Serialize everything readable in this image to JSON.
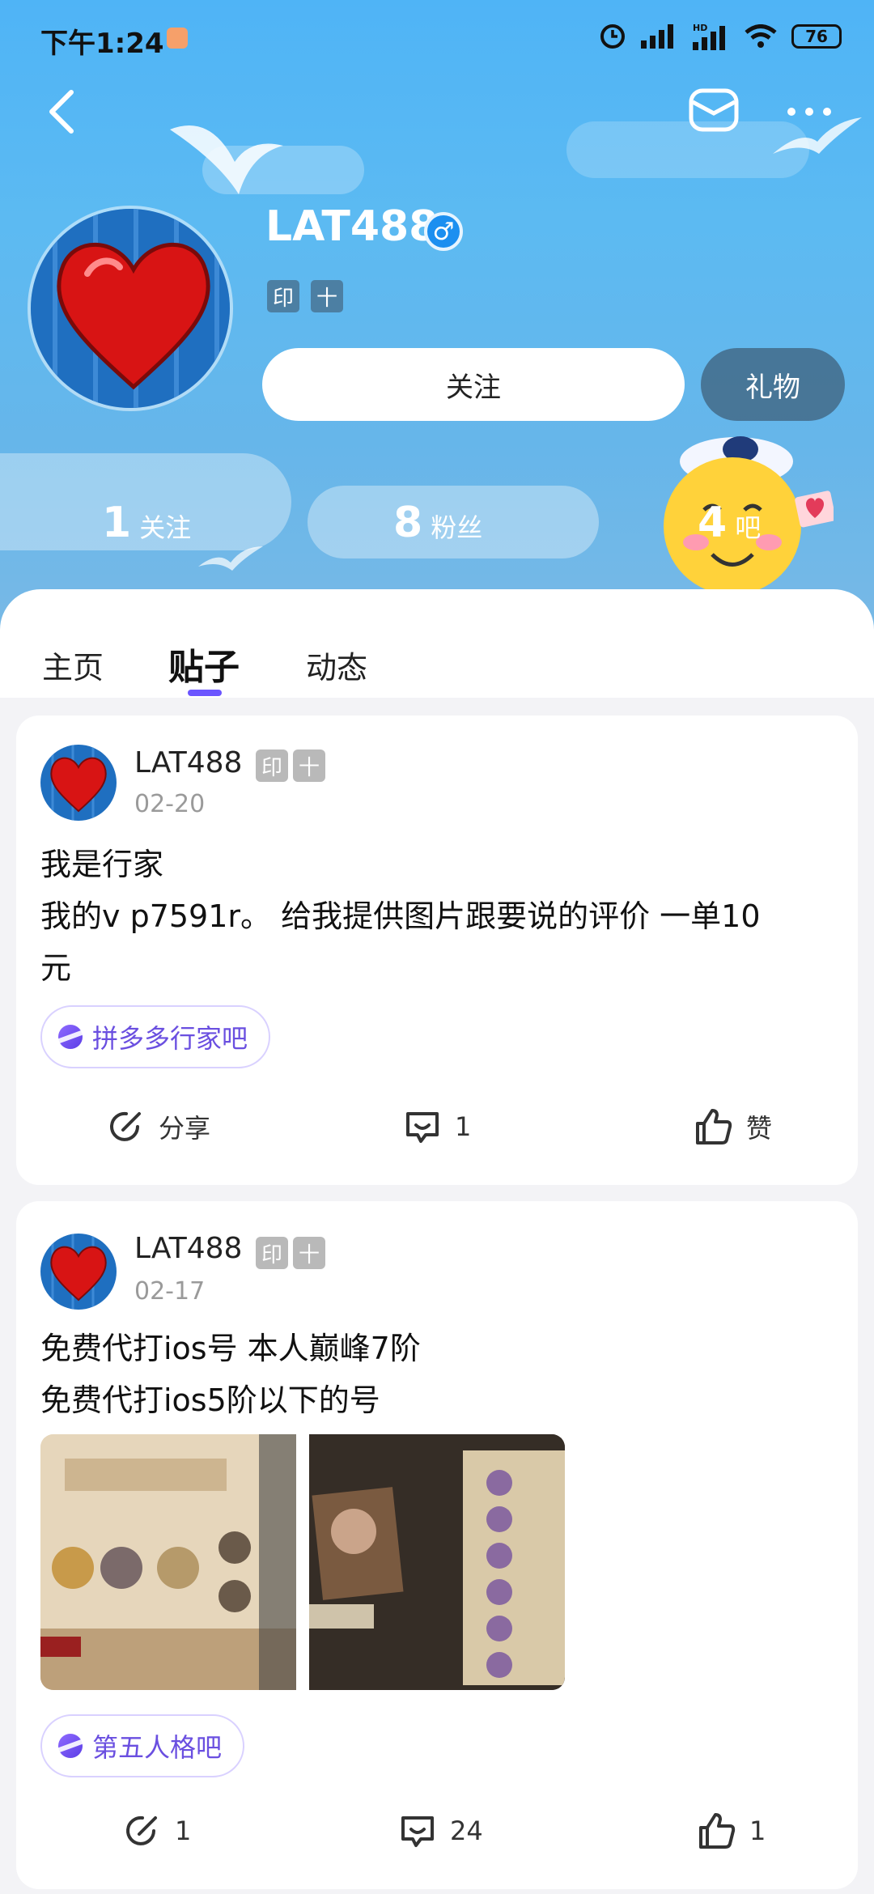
{
  "status_bar": {
    "time": "下午1:24",
    "battery": "76"
  },
  "profile": {
    "username": "LAT488",
    "gender_symbol": "♂",
    "tags": [
      "印",
      "十"
    ],
    "follow_label": "关注",
    "gift_label": "礼物",
    "stats": [
      {
        "value": "1",
        "label": "关注"
      },
      {
        "value": "8",
        "label": "粉丝"
      },
      {
        "value": "4",
        "label": "吧"
      }
    ]
  },
  "tabs": [
    {
      "label": "主页",
      "active": false
    },
    {
      "label": "贴子",
      "active": true
    },
    {
      "label": "动态",
      "active": false
    }
  ],
  "posts": [
    {
      "author": "LAT488",
      "tags": [
        "印",
        "十"
      ],
      "date": "02-20",
      "lines": [
        "我是行家",
        "我的v p7591r。 给我提供图片跟要说的评价 一单10",
        "元"
      ],
      "forum": "拼多多行家吧",
      "share": "分享",
      "comments": "1",
      "likes": "赞"
    },
    {
      "author": "LAT488",
      "tags": [
        "印",
        "十"
      ],
      "date": "02-17",
      "lines": [
        "免费代打ios号 本人巅峰7阶",
        "免费代打ios5阶以下的号"
      ],
      "forum": "第五人格吧",
      "share": "1",
      "comments": "24",
      "likes": "1"
    }
  ],
  "colors": {
    "accent": "#6b55ff",
    "banner": "#5cbaf2",
    "gender_badge": "#1c8ff0"
  }
}
